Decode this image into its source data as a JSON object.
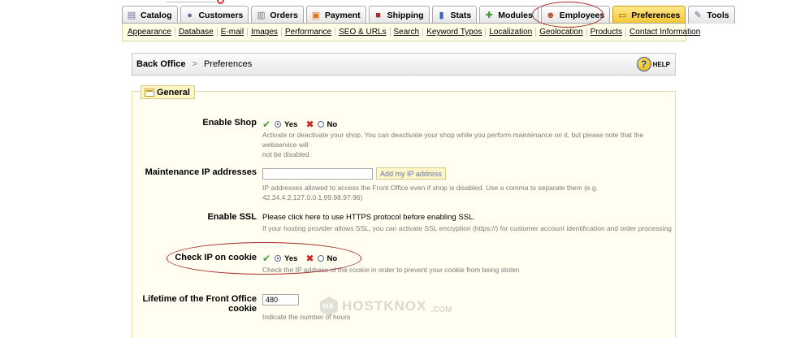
{
  "tabs": [
    {
      "label": "Catalog",
      "icon": "catalog-icon"
    },
    {
      "label": "Customers",
      "icon": "customers-icon"
    },
    {
      "label": "Orders",
      "icon": "orders-icon"
    },
    {
      "label": "Payment",
      "icon": "payment-icon"
    },
    {
      "label": "Shipping",
      "icon": "shipping-icon"
    },
    {
      "label": "Stats",
      "icon": "stats-icon"
    },
    {
      "label": "Modules",
      "icon": "modules-icon"
    },
    {
      "label": "Employees",
      "icon": "employees-icon"
    },
    {
      "label": "Preferences",
      "icon": "preferences-icon",
      "active": true
    },
    {
      "label": "Tools",
      "icon": "tools-icon"
    }
  ],
  "subnav": [
    "Appearance",
    "Database",
    "E-mail",
    "Images",
    "Performance",
    "SEO & URLs",
    "Search",
    "Keyword Typos",
    "Localization",
    "Geolocation",
    "Products",
    "Contact Information"
  ],
  "breadcrumb": {
    "home": "Back Office",
    "current": "Preferences"
  },
  "help_label": "HELP",
  "section_title": "General",
  "fields": {
    "enable_shop": {
      "label": "Enable Shop",
      "yes": "Yes",
      "no": "No",
      "desc_1": "Activate or deactivate your shop. You can deactivate your shop while you perform maintenance on it, but please note that the webservice will",
      "desc_2": "not be disabled"
    },
    "maintenance_ip": {
      "label": "Maintenance IP addresses",
      "value": "",
      "button": "Add my IP address",
      "desc": "IP addresses allowed to access the Front Office even if shop is disabled. Use a comma to separate them (e.g. 42.24.4.2,127.0.0.1,99.98.97.96)"
    },
    "enable_ssl": {
      "label": "Enable SSL",
      "text": "Please click here to use HTTPS protocol before enabling SSL.",
      "desc": "If your hosting provider allows SSL, you can activate SSL encryption (https://) for customer account identification and order processing"
    },
    "check_ip_cookie": {
      "label": "Check IP on cookie",
      "yes": "Yes",
      "no": "No",
      "desc": "Check the IP address of the cookie in order to prevent your cookie from being stolen"
    },
    "cookie_lifetime": {
      "label_1": "Lifetime of the Front Office",
      "label_2": "cookie",
      "value": "480",
      "desc": "Indicate the number of hours"
    }
  },
  "watermark": {
    "text": "HOSTKNOX",
    "suffix": ".COM",
    "logo_text": "HK"
  },
  "colors": {
    "active_tab": "#f3c533",
    "annotation": "#a82a2a",
    "check": "#3fa030",
    "cross": "#d22222"
  }
}
